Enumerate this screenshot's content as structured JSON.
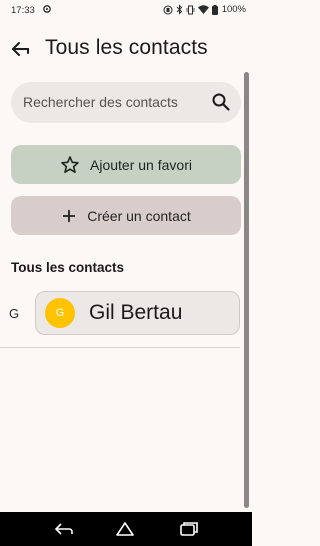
{
  "status_bar": {
    "time": "17:33",
    "battery": "100%",
    "icons": [
      "settings-icon",
      "bluetooth-icon",
      "vibrate-icon",
      "wifi-icon",
      "battery-icon"
    ]
  },
  "header": {
    "title": "Tous les contacts",
    "back_icon": "arrow-back-icon"
  },
  "search": {
    "placeholder": "Rechercher des contacts",
    "icon": "search-icon"
  },
  "actions": {
    "add_favorite": "Ajouter un favori",
    "create_contact": "Créer un contact"
  },
  "section": {
    "title": "Tous les contacts"
  },
  "contacts": [
    {
      "letter": "G",
      "initial": "G",
      "name": "Gil Bertau",
      "avatar_color": "#fec200"
    }
  ],
  "nav_bar": {
    "icons": [
      "back-icon",
      "home-icon",
      "recents-icon"
    ]
  },
  "colors": {
    "background": "#fcf8f5",
    "favorite_button": "#c6d0c3",
    "create_button": "#d9cdcb",
    "search_bg": "#ebe8e6"
  }
}
